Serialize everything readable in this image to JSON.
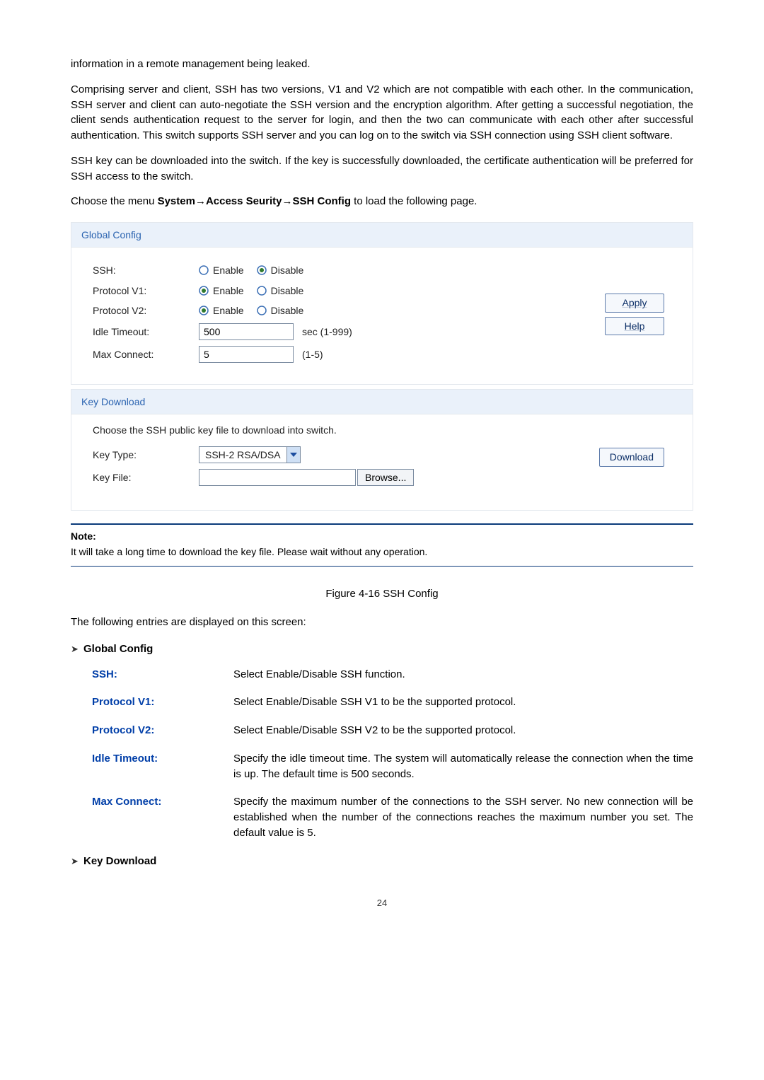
{
  "paragraphs": {
    "p1": "information in a remote management being leaked.",
    "p2": "Comprising server and client, SSH has two versions, V1 and V2 which are not compatible with each other. In the communication, SSH server and client can auto-negotiate the SSH version and the encryption algorithm. After getting a successful negotiation, the client sends authentication request to the server for login, and then the two can communicate with each other after successful authentication. This switch supports SSH server and you can log on to the switch via SSH connection using SSH client software.",
    "p3": "SSH key can be downloaded into the switch. If the key is successfully downloaded, the certificate authentication will be preferred for SSH access to the switch."
  },
  "menu_path": {
    "prefix": "Choose the menu ",
    "bold": "System→Access Seurity→SSH Config",
    "suffix": " to load the following page."
  },
  "global_config_panel": {
    "title": "Global Config",
    "rows": {
      "ssh_label": "SSH:",
      "v1_label": "Protocol V1:",
      "v2_label": "Protocol V2:",
      "idle_label": "Idle Timeout:",
      "max_label": "Max Connect:"
    },
    "radio": {
      "enable": "Enable",
      "disable": "Disable"
    },
    "idle_value": "500",
    "idle_unit": "sec (1-999)",
    "max_value": "5",
    "max_unit": "(1-5)",
    "apply": "Apply",
    "help": "Help"
  },
  "key_download_panel": {
    "title": "Key Download",
    "instruction": "Choose the SSH public key file to download into switch.",
    "key_type_label": "Key Type:",
    "key_type_value": "SSH-2 RSA/DSA",
    "key_file_label": "Key File:",
    "browse": "Browse...",
    "download": "Download"
  },
  "note": {
    "title": "Note:",
    "text": "It will take a long time to download the key file. Please wait without any operation."
  },
  "figure_caption": "Figure 4-16 SSH Config",
  "entries_intro": "The following entries are displayed on this screen:",
  "section_headings": {
    "global_config": "Global Config",
    "key_download": "Key Download"
  },
  "definitions": {
    "ssh": {
      "term": "SSH:",
      "desc": "Select Enable/Disable SSH function."
    },
    "v1": {
      "term": "Protocol V1:",
      "desc": "Select Enable/Disable SSH V1 to be the supported protocol."
    },
    "v2": {
      "term": "Protocol V2:",
      "desc": "Select Enable/Disable SSH V2 to be the supported protocol."
    },
    "idle": {
      "term": "Idle Timeout:",
      "desc": "Specify the idle timeout time. The system will automatically release the connection when the time is up. The default time is 500 seconds."
    },
    "max": {
      "term": "Max Connect:",
      "desc": "Specify the maximum number of the connections to the SSH server. No new connection will be established when the number of the connections reaches the maximum number you set. The default value is 5."
    }
  },
  "page_number": "24"
}
